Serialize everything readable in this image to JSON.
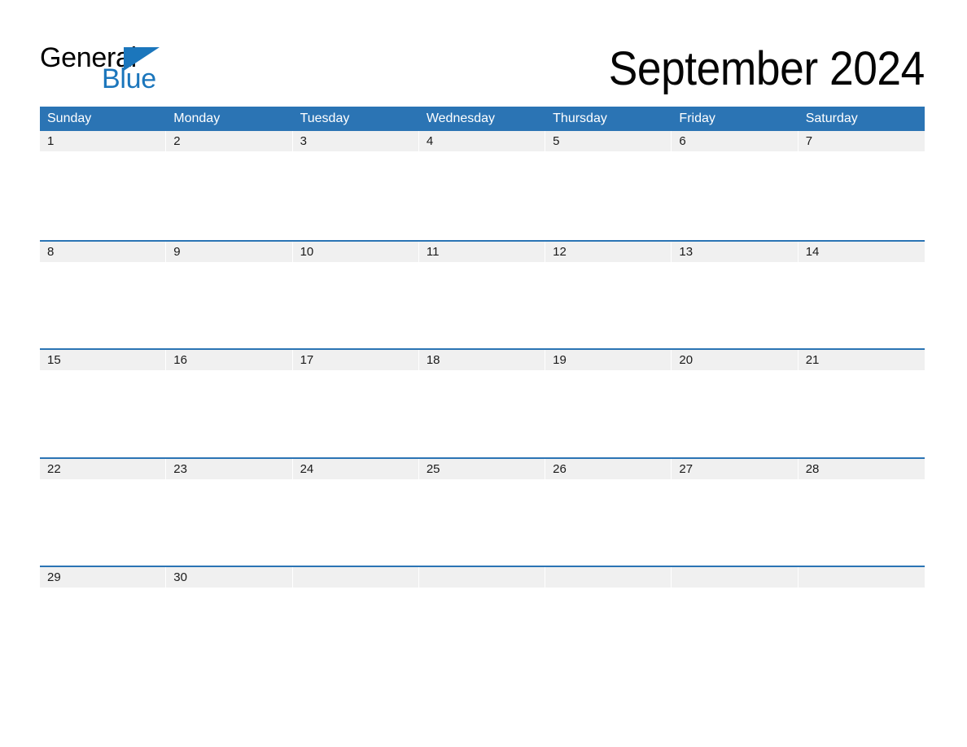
{
  "brand": {
    "name_part_one": "General",
    "name_part_two": "Blue",
    "triangle_icon": "triangle-icon",
    "color_black": "#000000",
    "color_blue": "#1b76bc"
  },
  "header": {
    "title": "September 2024",
    "month": "September",
    "year": "2024"
  },
  "theme": {
    "header_blue": "#2b74b4",
    "date_band_gray": "#f0f0f0",
    "separator_blue": "#2b74b4",
    "page_background": "#ffffff",
    "text_dark": "#1a1a1a",
    "text_white": "#ffffff"
  },
  "calendar": {
    "weekdays": [
      "Sunday",
      "Monday",
      "Tuesday",
      "Wednesday",
      "Thursday",
      "Friday",
      "Saturday"
    ],
    "weeks": [
      {
        "index": 1,
        "days": [
          {
            "date": "1",
            "empty": false
          },
          {
            "date": "2",
            "empty": false
          },
          {
            "date": "3",
            "empty": false
          },
          {
            "date": "4",
            "empty": false
          },
          {
            "date": "5",
            "empty": false
          },
          {
            "date": "6",
            "empty": false
          },
          {
            "date": "7",
            "empty": false
          }
        ]
      },
      {
        "index": 2,
        "days": [
          {
            "date": "8",
            "empty": false
          },
          {
            "date": "9",
            "empty": false
          },
          {
            "date": "10",
            "empty": false
          },
          {
            "date": "11",
            "empty": false
          },
          {
            "date": "12",
            "empty": false
          },
          {
            "date": "13",
            "empty": false
          },
          {
            "date": "14",
            "empty": false
          }
        ]
      },
      {
        "index": 3,
        "days": [
          {
            "date": "15",
            "empty": false
          },
          {
            "date": "16",
            "empty": false
          },
          {
            "date": "17",
            "empty": false
          },
          {
            "date": "18",
            "empty": false
          },
          {
            "date": "19",
            "empty": false
          },
          {
            "date": "20",
            "empty": false
          },
          {
            "date": "21",
            "empty": false
          }
        ]
      },
      {
        "index": 4,
        "days": [
          {
            "date": "22",
            "empty": false
          },
          {
            "date": "23",
            "empty": false
          },
          {
            "date": "24",
            "empty": false
          },
          {
            "date": "25",
            "empty": false
          },
          {
            "date": "26",
            "empty": false
          },
          {
            "date": "27",
            "empty": false
          },
          {
            "date": "28",
            "empty": false
          }
        ]
      },
      {
        "index": 5,
        "days": [
          {
            "date": "29",
            "empty": false
          },
          {
            "date": "30",
            "empty": false
          },
          {
            "date": "",
            "empty": true
          },
          {
            "date": "",
            "empty": true
          },
          {
            "date": "",
            "empty": true
          },
          {
            "date": "",
            "empty": true
          },
          {
            "date": "",
            "empty": true
          }
        ]
      }
    ]
  }
}
